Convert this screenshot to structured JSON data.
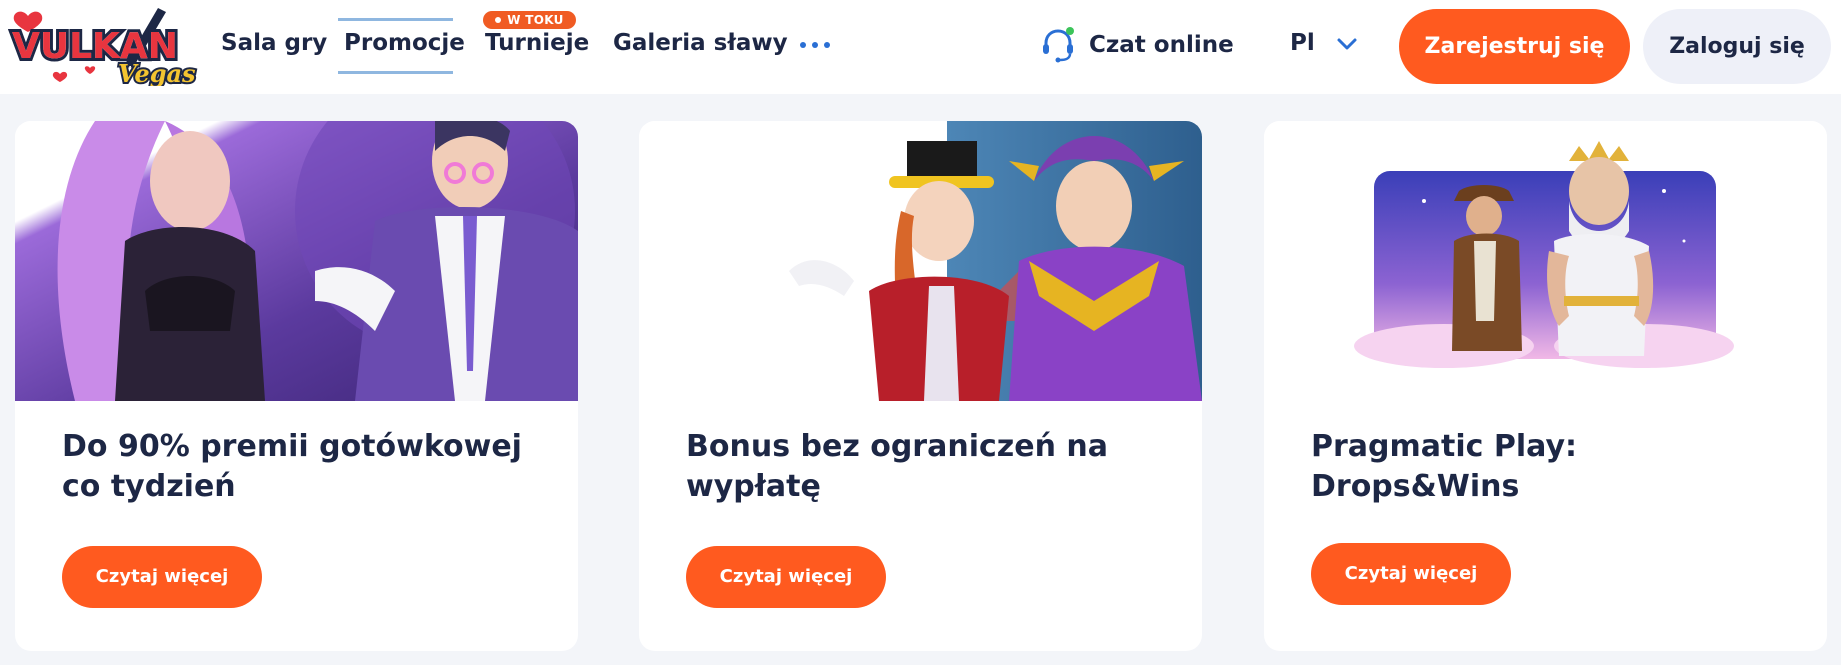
{
  "header": {
    "logo": {
      "text_main": "VULKAN",
      "text_sub": "Vegas"
    },
    "nav": {
      "sala_gry": "Sala gry",
      "promocje": "Promocje",
      "turnieje": "Turnieje",
      "turnieje_badge": "W TOKU",
      "galeria": "Galeria sławy",
      "more_icon": "ellipsis-icon"
    },
    "chat_label": "Czat online",
    "chat_icon": "headset-icon",
    "language": "Pl",
    "register_label": "Zarejestruj się",
    "login_label": "Zaloguj się"
  },
  "colors": {
    "accent_orange": "#ff5a1f",
    "navy_text": "#1d2745",
    "link_blue": "#2a6fd4",
    "page_bg": "#f3f5f9"
  },
  "cards": [
    {
      "title": "Do 90% premii gotówkowej co tydzień",
      "button": "Czytaj więcej",
      "image": "anime-characters-illustration"
    },
    {
      "title": "Bonus bez ograniczeń na wypłatę",
      "button": "Czytaj więcej",
      "image": "ringmaster-and-jester-illustration"
    },
    {
      "title": "Pragmatic Play: Drops&Wins",
      "button": "Czytaj więcej",
      "image": "adventurer-and-zeus-banner"
    }
  ]
}
